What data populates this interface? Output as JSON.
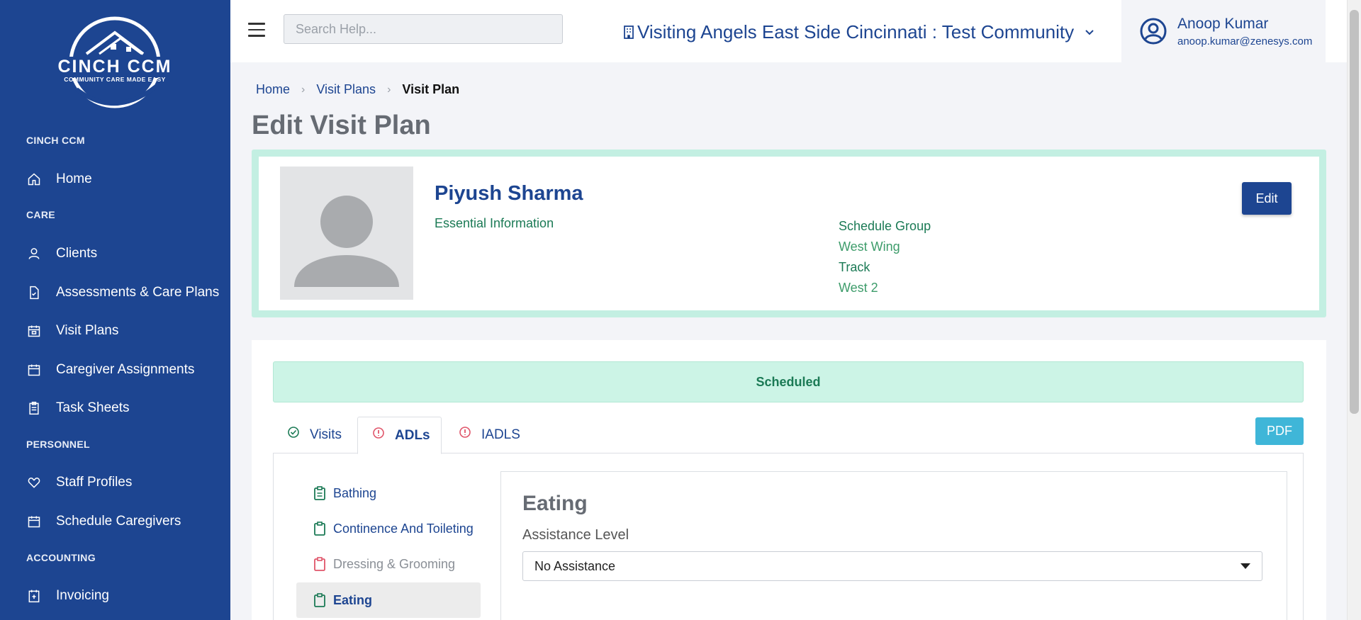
{
  "brand": {
    "logo_text": "CINCH CCM",
    "logo_tagline": "COMMUNITY CARE MADE EASY"
  },
  "sidebar": {
    "sections": {
      "cinch": "CINCH CCM",
      "care": "CARE",
      "personnel": "PERSONNEL",
      "accounting": "ACCOUNTING"
    },
    "items": [
      {
        "label": "Home",
        "icon": "home-icon"
      },
      {
        "label": "Clients",
        "icon": "user-icon"
      },
      {
        "label": "Assessments & Care Plans",
        "icon": "document-icon"
      },
      {
        "label": "Visit Plans",
        "icon": "calendar-icon"
      },
      {
        "label": "Caregiver Assignments",
        "icon": "calendar-icon"
      },
      {
        "label": "Task Sheets",
        "icon": "clipboard-icon"
      },
      {
        "label": "Staff Profiles",
        "icon": "heart-icon"
      },
      {
        "label": "Schedule Caregivers",
        "icon": "calendar-icon"
      },
      {
        "label": "Invoicing",
        "icon": "invoice-icon"
      }
    ]
  },
  "header": {
    "search_placeholder": "Search Help...",
    "community": "Visiting Angels East Side Cincinnati : Test Community",
    "user_name": "Anoop Kumar",
    "user_email": "anoop.kumar@zenesys.com"
  },
  "breadcrumb": {
    "home": "Home",
    "visit_plans": "Visit Plans",
    "current": "Visit Plan"
  },
  "page_title": "Edit Visit Plan",
  "client": {
    "name": "Piyush Sharma",
    "essential": "Essential Information",
    "schedule_group_label": "Schedule Group",
    "schedule_group_value": "West Wing",
    "track_label": "Track",
    "track_value": "West 2",
    "edit_label": "Edit"
  },
  "status": "Scheduled",
  "tabs": [
    {
      "label": "Visits",
      "state": "ok"
    },
    {
      "label": "ADLs",
      "state": "warning"
    },
    {
      "label": "IADLS",
      "state": "warning"
    }
  ],
  "pdf_label": "PDF",
  "adl_list": [
    {
      "label": "Bathing",
      "state": "complete"
    },
    {
      "label": "Continence And Toileting",
      "state": "complete"
    },
    {
      "label": "Dressing & Grooming",
      "state": "incomplete"
    },
    {
      "label": "Eating",
      "state": "complete"
    }
  ],
  "detail": {
    "title": "Eating",
    "assistance_label": "Assistance Level",
    "assistance_value": "No Assistance"
  },
  "colors": {
    "brand": "#1d4591",
    "success": "#1b7a55",
    "danger": "#e0556a",
    "status_bg": "#ccf4e6",
    "pdf": "#3fb6d8"
  }
}
